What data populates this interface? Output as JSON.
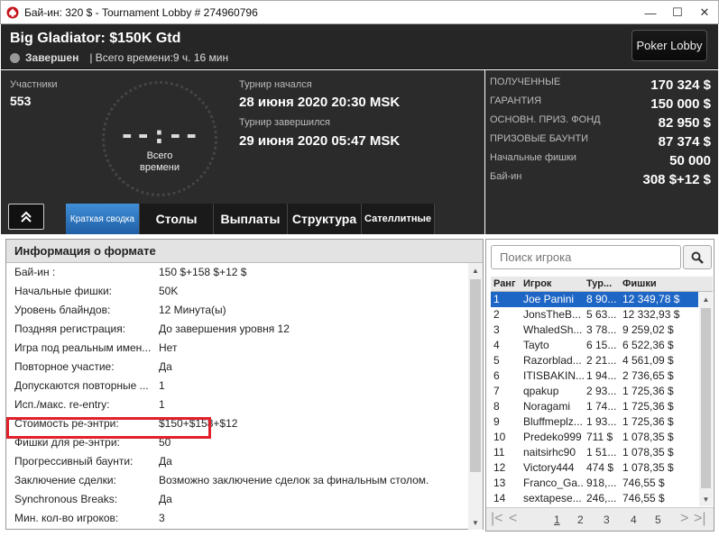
{
  "window": {
    "title": "Бай-ин: 320 $ - Tournament Lobby # 274960796",
    "icon": "pokerstars-spade-icon"
  },
  "header": {
    "tournament_name": "Big Gladiator: $150K Gtd",
    "status": "Завершен",
    "total_time": "| Всего времени:9 ч. 16 мин",
    "lobby_button": "Poker Lobby"
  },
  "overview": {
    "participants_label": "Участники",
    "participants": "553",
    "clock_digits": "--:--",
    "clock_caption_1": "Всего",
    "clock_caption_2": "времени",
    "started_label": "Турнир начался",
    "started": "28 июня 2020  20:30 MSK",
    "ended_label": "Турнир завершился",
    "ended": "29 июня 2020  05:47 MSK"
  },
  "tabs": [
    {
      "label": "Краткая сводка",
      "active": true
    },
    {
      "label": "Столы",
      "active": false
    },
    {
      "label": "Выплаты",
      "active": false
    },
    {
      "label": "Структура",
      "active": false
    },
    {
      "label": "Сателлитные",
      "active": false
    }
  ],
  "prizes": [
    {
      "label": "ПОЛУЧЕННЫЕ",
      "value": "170 324 $"
    },
    {
      "label": "ГАРАНТИЯ",
      "value": "150 000 $"
    },
    {
      "label": "ОСНОВН. ПРИЗ. ФОНД",
      "value": "82 950 $"
    },
    {
      "label": "ПРИЗОВЫЕ БАУНТИ",
      "value": "87 374 $"
    },
    {
      "label": "Начальные фишки",
      "value": "50 000"
    },
    {
      "label": "Бай-ин",
      "value": "308 $+12 $"
    }
  ],
  "info": {
    "title": "Информация о формате",
    "rows": [
      {
        "key": "Бай-ин :",
        "value": "150 $+158 $+12 $"
      },
      {
        "key": "Начальные фишки:",
        "value": "50K"
      },
      {
        "key": "Уровень блайндов:",
        "value": "12 Минута(ы)"
      },
      {
        "key": "Поздняя регистрация:",
        "value": "До завершения уровня 12"
      },
      {
        "key": "Игра под реальным имен...",
        "value": "Нет"
      },
      {
        "key": "Повторное участие:",
        "value": "Да"
      },
      {
        "key": "Допускаются повторные ...",
        "value": "1"
      },
      {
        "key": "Исп./макс. re-entry:",
        "value": "1"
      },
      {
        "key": "Стоимость ре-энтри:",
        "value": "$150+$158+$12"
      },
      {
        "key": "Фишки для ре-энтри:",
        "value": "50"
      },
      {
        "key": "Прогрессивный баунти:",
        "value": "Да"
      },
      {
        "key": "Заключение сделки:",
        "value": "Возможно заключение сделок за финальным столом."
      },
      {
        "key": "Synchronous Breaks:",
        "value": "Да"
      },
      {
        "key": "Мин. кол-во игроков:",
        "value": "3"
      }
    ]
  },
  "players": {
    "search_placeholder": "Поиск игрока",
    "columns": [
      "Ранг",
      "Игрок",
      "Тур...",
      "Фишки"
    ],
    "rows": [
      {
        "rank": "1",
        "name": "Joe Panini",
        "tour": "8 90...",
        "chips": "12 349,78 $"
      },
      {
        "rank": "2",
        "name": "JonsTheB...",
        "tour": "5 63...",
        "chips": "12 332,93 $"
      },
      {
        "rank": "3",
        "name": "WhaledSh...",
        "tour": "3 78...",
        "chips": "9 259,02 $"
      },
      {
        "rank": "4",
        "name": "Tayto",
        "tour": "6 15...",
        "chips": "6 522,36 $"
      },
      {
        "rank": "5",
        "name": "Razorblad...",
        "tour": "2 21...",
        "chips": "4 561,09 $"
      },
      {
        "rank": "6",
        "name": "ITISBAKIN...",
        "tour": "1 94...",
        "chips": "2 736,65 $"
      },
      {
        "rank": "7",
        "name": "qpakup",
        "tour": "2 93...",
        "chips": "1 725,36 $"
      },
      {
        "rank": "8",
        "name": "Noragami",
        "tour": "1 74...",
        "chips": "1 725,36 $"
      },
      {
        "rank": "9",
        "name": "Bluffmeplz...",
        "tour": "1 93...",
        "chips": "1 725,36 $"
      },
      {
        "rank": "10",
        "name": "Predeko999",
        "tour": "711 $",
        "chips": "1 078,35 $"
      },
      {
        "rank": "11",
        "name": "naitsirhc90",
        "tour": "1 51...",
        "chips": "1 078,35 $"
      },
      {
        "rank": "12",
        "name": "Victory444",
        "tour": "474 $",
        "chips": "1 078,35 $"
      },
      {
        "rank": "13",
        "name": "Franco_Ga...",
        "tour": "918,...",
        "chips": "746,55 $"
      },
      {
        "rank": "14",
        "name": "sextapese...",
        "tour": "246,...",
        "chips": "746,55 $"
      }
    ],
    "pages": [
      "1",
      "2",
      "3",
      "4",
      "5"
    ],
    "current_page": "1"
  }
}
